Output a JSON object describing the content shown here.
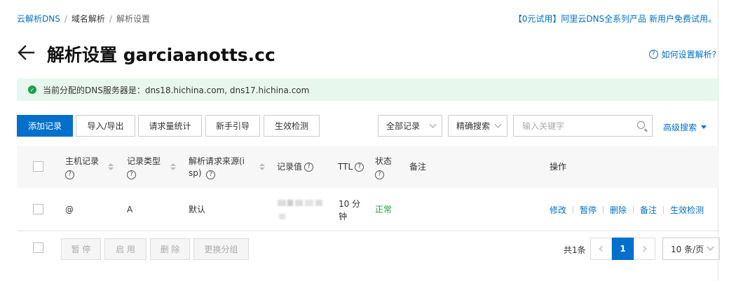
{
  "breadcrumb": {
    "items": [
      "云解析DNS",
      "域名解析",
      "解析设置"
    ]
  },
  "promo": "【0元试用】阿里云DNS全系列产品 新用户免费试用。",
  "page": {
    "title": "解析设置 garciaanotts.cc",
    "help": "如何设置解析?"
  },
  "notice": {
    "text": "当前分配的DNS服务器是：dns18.hichina.com, dns17.hichina.com"
  },
  "toolbar": {
    "add": "添加记录",
    "import_export": "导入/导出",
    "stats": "请求量统计",
    "guide": "新手引导",
    "check": "生效检测",
    "filter_select": "全部记录",
    "search_mode": "精确搜索",
    "search_placeholder": "输入关键字",
    "advanced": "高级搜索"
  },
  "table": {
    "columns": {
      "host": "主机记录",
      "type": "记录类型",
      "source": "解析请求来源(isp)",
      "value": "记录值",
      "ttl": "TTL",
      "status": "状态",
      "remark": "备注",
      "actions": "操作"
    },
    "rows": [
      {
        "host": "@",
        "type": "A",
        "source": "默认",
        "ttl": "10 分钟",
        "status": "正常",
        "remark": "",
        "actions": [
          "修改",
          "暂停",
          "删除",
          "备注",
          "生效检测"
        ]
      }
    ]
  },
  "bulk": {
    "pause": "暂 停",
    "enable": "启 用",
    "delete": "删 除",
    "change_group": "更换分组"
  },
  "pagination": {
    "total": "共1条",
    "current": "1",
    "page_size": "10 条/页"
  },
  "colors": {
    "primary": "#0070cc",
    "success": "#1e9e4a",
    "notice_bg": "#e8f7ed"
  }
}
